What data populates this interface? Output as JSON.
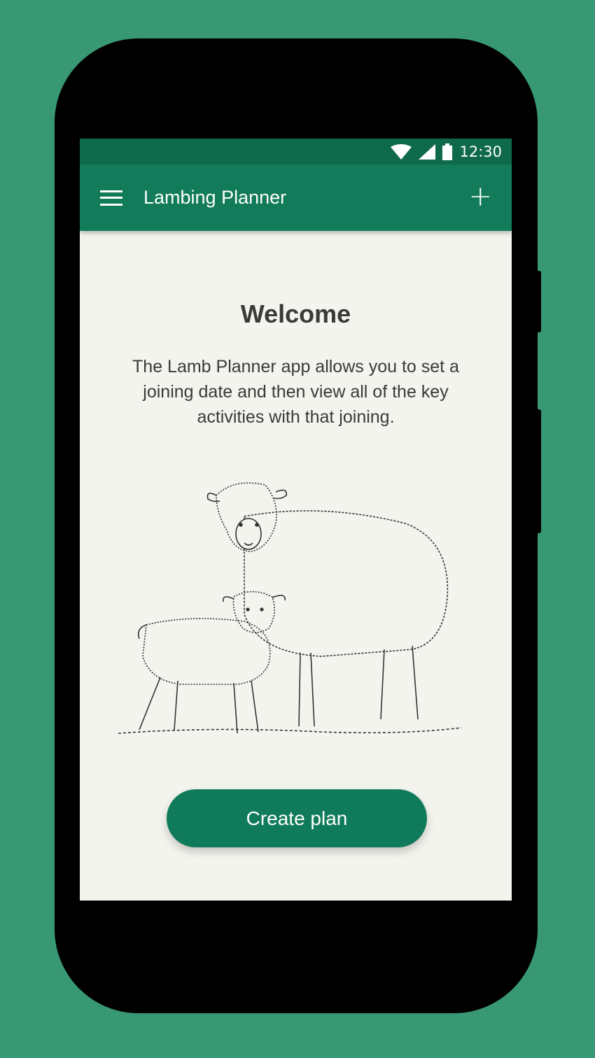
{
  "status_bar": {
    "time": "12:30",
    "icons": [
      "wifi-icon",
      "signal-icon",
      "battery-icon"
    ]
  },
  "app_bar": {
    "title": "Lambing Planner",
    "menu_icon": "hamburger-menu-icon",
    "action_icon": "plus-icon"
  },
  "main": {
    "heading": "Welcome",
    "description": "The Lamb Planner app allows you to set a joining date and then view all of the key activities with that joining.",
    "illustration": "ewe-and-lamb-sketch",
    "cta_label": "Create plan"
  },
  "colors": {
    "background": "#389873",
    "status_bar": "#0f6a4c",
    "app_bar": "#117b5a",
    "content": "#f4f4ee",
    "button": "#107b5a"
  }
}
